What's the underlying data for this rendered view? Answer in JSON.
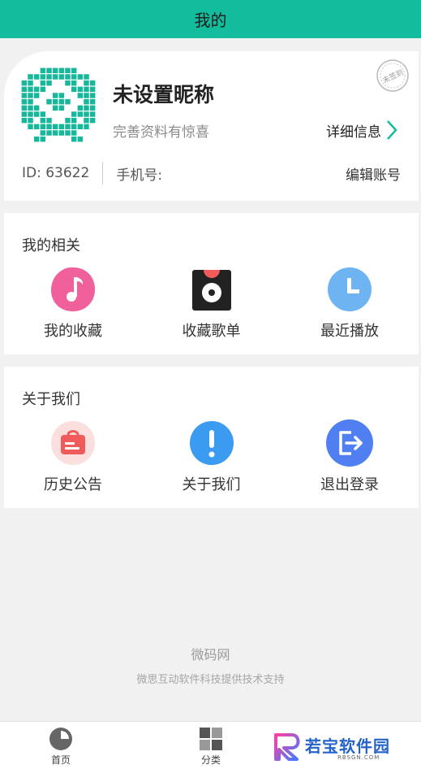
{
  "header": {
    "title": "我的"
  },
  "profile": {
    "nickname": "未设置昵称",
    "subtitle": "完善资料有惊喜",
    "detail_label": "详细信息",
    "stamp_text": "未签到",
    "id_label": "ID: 63622",
    "phone_label": "手机号:",
    "edit_label": "编辑账号"
  },
  "related": {
    "title": "我的相关",
    "items": [
      {
        "label": "我的收藏",
        "icon": "music-note-icon",
        "color": "#f0609a"
      },
      {
        "label": "收藏歌单",
        "icon": "record-box-icon",
        "color": "#222222"
      },
      {
        "label": "最近播放",
        "icon": "clock-icon",
        "color": "#6fb4f2"
      }
    ]
  },
  "about": {
    "title": "关于我们",
    "items": [
      {
        "label": "历史公告",
        "icon": "notice-bag-icon",
        "color": "#ef5b5b"
      },
      {
        "label": "关于我们",
        "icon": "exclamation-icon",
        "color": "#3a9bf0"
      },
      {
        "label": "退出登录",
        "icon": "logout-icon",
        "color": "#4f7ff0"
      }
    ]
  },
  "footer": {
    "brand": "微码网",
    "support": "微思互动软件科技提供技术支持"
  },
  "tabbar": {
    "home_label": "首页",
    "category_label": "分类"
  },
  "watermark": {
    "text": "若宝软件园",
    "sub": "RBSGN.COM"
  },
  "colors": {
    "primary": "#14bc9e",
    "avatar": "#17b79b"
  }
}
